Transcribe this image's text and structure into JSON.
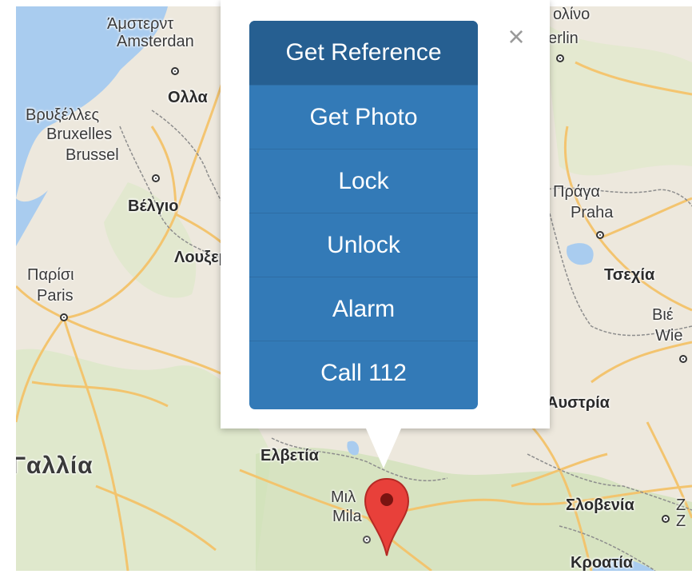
{
  "map": {
    "labels": {
      "amsterdam_el": "Άμστερντ",
      "amsterdam": "Amsterdan",
      "netherlands": "Ολλα",
      "brussels_el": "Βρυξέλλες",
      "bruxelles": "Bruxelles",
      "brussel": "Brussel",
      "belgium": "Βέλγιο",
      "luxembourg": "Λουξεμ",
      "paris_el": "Παρίσι",
      "paris": "Paris",
      "france": "Γαλλία",
      "switzerland": "Ελβετία",
      "milan_el": "Μιλ",
      "milan": "Mila",
      "berlin_el": "ολίνο",
      "berlin": "erlin",
      "prague_el": "Πράγα",
      "prague": "Praha",
      "czechia": "Τσεχία",
      "vienna_el": "Βιέ",
      "vienna": "Wie",
      "austria": "Αυστρία",
      "slovenia": "Σλοβενία",
      "croatia": "Κροατία",
      "z1": "Z",
      "z2": "Z"
    }
  },
  "popup": {
    "close_symbol": "×",
    "buttons": [
      {
        "label": "Get Reference"
      },
      {
        "label": "Get Photo"
      },
      {
        "label": "Lock"
      },
      {
        "label": "Unlock"
      },
      {
        "label": "Alarm"
      },
      {
        "label": "Call 112"
      }
    ]
  },
  "colors": {
    "button": "#337ab7",
    "button_active": "#265f91",
    "marker": "#e8403a",
    "water": "#a4c8ee",
    "land": "#ece7dc"
  }
}
